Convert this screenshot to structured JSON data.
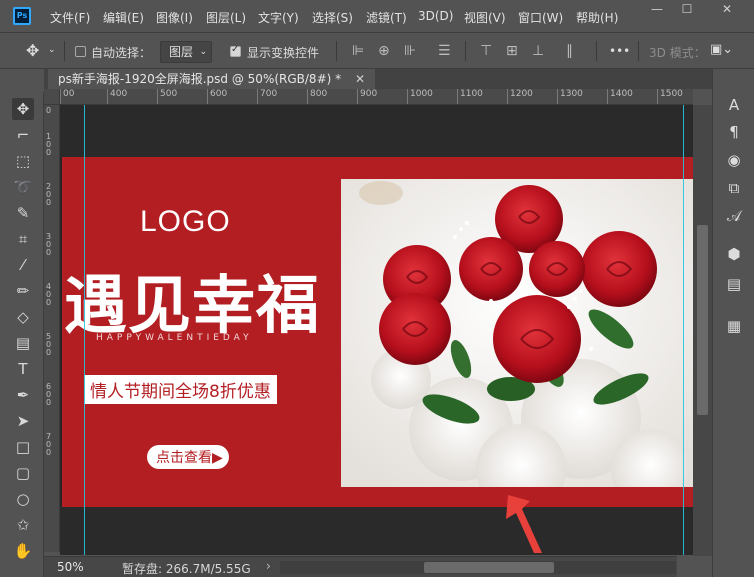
{
  "app": {
    "logo": "Ps"
  },
  "menu": [
    "文件(F)",
    "编辑(E)",
    "图像(I)",
    "图层(L)",
    "文字(Y)",
    "选择(S)",
    "滤镜(T)",
    "3D(D)",
    "视图(V)",
    "窗口(W)",
    "帮助(H)"
  ],
  "window_buttons": {
    "minimize": "—",
    "maximize": "☐",
    "close": "✕"
  },
  "options": {
    "auto_select_label": "自动选择：",
    "auto_select_checked": false,
    "auto_select_target": "图层",
    "show_transform_label": "显示变换控件",
    "show_transform_checked": true,
    "more": "•••",
    "mode_3d": "3D 模式："
  },
  "document": {
    "tab_title": "ps新手海报-1920全屏海报.psd @ 50%(RGB/8#) *",
    "close": "✕"
  },
  "ruler": {
    "h_ticks": [
      "00",
      "400",
      "500",
      "600",
      "700",
      "800",
      "900",
      "1000",
      "1100",
      "1200",
      "1300",
      "1400",
      "1500"
    ],
    "v_ticks": [
      "0",
      "1",
      "0",
      "0",
      "2",
      "0",
      "0",
      "3",
      "0",
      "0",
      "4",
      "0",
      "0",
      "5",
      "0",
      "0",
      "6",
      "0",
      "0",
      "7",
      "0",
      "0"
    ]
  },
  "poster": {
    "logo": "LOGO",
    "headline": "遇见幸福",
    "subtitle": "HAPPYWALENTIEDAY",
    "promo": "情人节期间全场8折优惠",
    "cta": "点击查看▶",
    "red": "#b31e22"
  },
  "status": {
    "zoom": "50%",
    "scratch": "暂存盘: 266.7M/5.55G",
    "arrow": "›"
  },
  "tools_left": [
    "move-icon",
    "artboard-icon",
    "marquee-icon",
    "lasso-icon",
    "quick-select-icon",
    "crop-icon",
    "eyedropper-icon",
    "brush-icon",
    "eraser-icon",
    "gradient-icon",
    "type-icon",
    "pen-icon",
    "path-select-icon",
    "rectangle-icon",
    "rounded-rect-icon",
    "ellipse-icon",
    "custom-shape-icon",
    "hand-icon"
  ],
  "tools_right": [
    "character-icon",
    "paragraph-icon",
    "color-icon",
    "adjustments-icon",
    "glyphs-icon",
    "3d-icon",
    "layers-icon",
    "grid-icon"
  ]
}
